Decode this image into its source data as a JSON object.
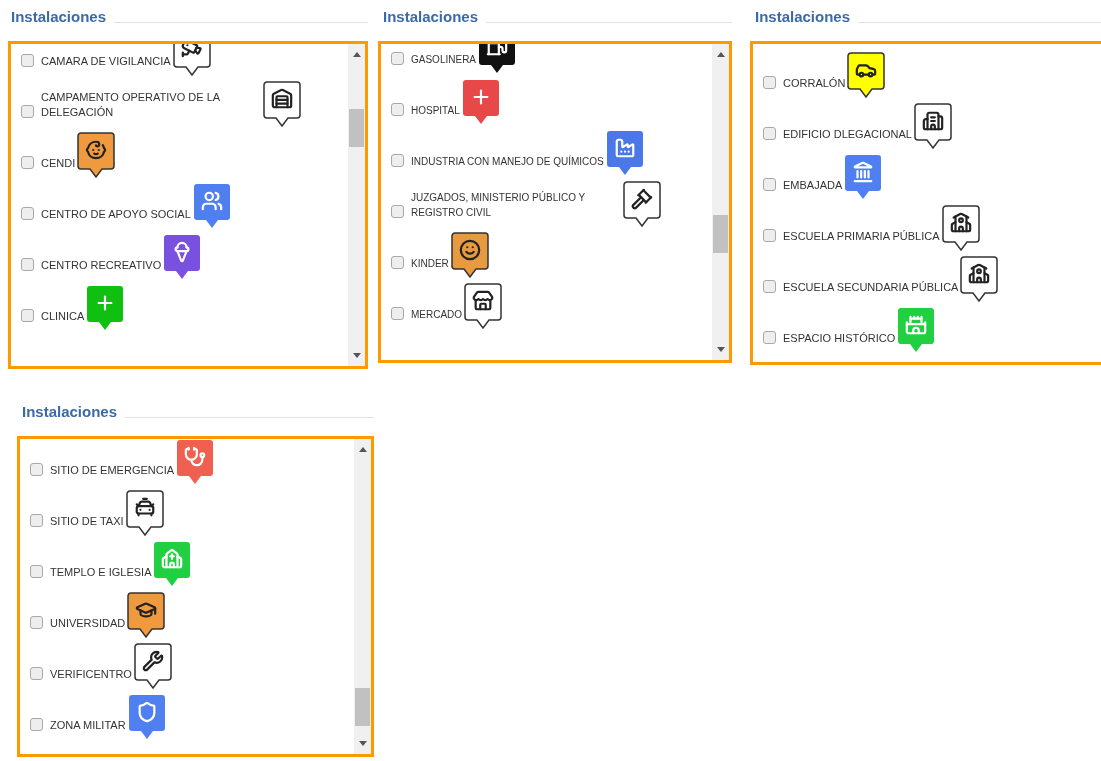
{
  "panels": [
    {
      "title": "Instalaciones",
      "items": [
        {
          "label": "CAMARA DE VIGILANCIA",
          "checked": false
        },
        {
          "label": "CAMPAMENTO OPERATIVO DE LA DELEGACIÓN",
          "checked": false
        },
        {
          "label": "CENDI",
          "checked": false,
          "color": "#f09a40"
        },
        {
          "label": "CENTRO DE APOYO SOCIAL",
          "checked": false,
          "color": "#5080f0"
        },
        {
          "label": "CENTRO RECREATIVO",
          "checked": false,
          "color": "#7a50e0"
        },
        {
          "label": "CLINICA",
          "checked": false,
          "color": "#10c010"
        }
      ]
    },
    {
      "title": "Instalaciones",
      "items": [
        {
          "label": "GASOLINERA",
          "checked": false,
          "color": "#111111"
        },
        {
          "label": "HOSPITAL",
          "checked": false,
          "color": "#e84848"
        },
        {
          "label": "INDUSTRIA CON MANEJO DE QUÍMICOS",
          "checked": false,
          "color": "#4a78e8"
        },
        {
          "label": "JUZGADOS, MINISTERIO PÚBLICO Y REGISTRO CIVIL",
          "checked": false
        },
        {
          "label": "KINDER",
          "checked": false,
          "color": "#e89a40"
        },
        {
          "label": "MERCADO",
          "checked": false
        }
      ]
    },
    {
      "title": "Instalaciones",
      "items": [
        {
          "label": "CORRALÓN",
          "checked": false,
          "color": "#ffff00"
        },
        {
          "label": "EDIFICIO DLEGACIONAL",
          "checked": false
        },
        {
          "label": "EMBAJADA",
          "checked": false,
          "color": "#4f7ff0"
        },
        {
          "label": "ESCUELA PRIMARIA PÚBLICA",
          "checked": false
        },
        {
          "label": "ESCUELA SECUNDARIA PÚBLICA",
          "checked": false
        },
        {
          "label": "ESPACIO HISTÓRICO",
          "checked": false,
          "color": "#20d040"
        }
      ]
    },
    {
      "title": "Instalaciones",
      "items": [
        {
          "label": "SITIO DE EMERGENCIA",
          "checked": false,
          "color": "#f06050"
        },
        {
          "label": "SITIO DE TAXI",
          "checked": false
        },
        {
          "label": "TEMPLO E IGLESIA",
          "checked": false,
          "color": "#20d040"
        },
        {
          "label": "UNIVERSIDAD",
          "checked": false,
          "color": "#f09a40"
        },
        {
          "label": "VERIFICENTRO",
          "checked": false
        },
        {
          "label": "ZONA MILITAR",
          "checked": false,
          "color": "#5080f0"
        }
      ]
    }
  ]
}
